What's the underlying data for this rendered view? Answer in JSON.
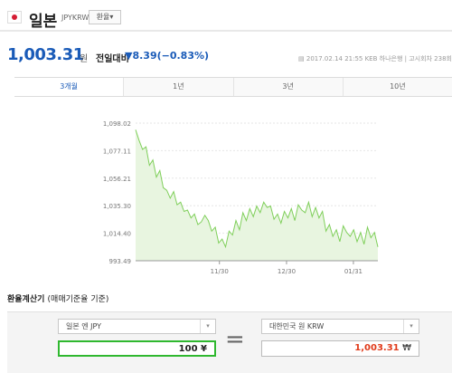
{
  "header": {
    "country": "일본",
    "code": "JPYKRW",
    "switch_label": "환율"
  },
  "rate": {
    "value": "1,003.31",
    "unit": "원",
    "prev_label": "전일대비",
    "change": "▼8.39(−0.83%)",
    "meta": "2017.02.14 21:55 KEB 하나은행 | 고시회차 238회"
  },
  "tabs": [
    "3개월",
    "1년",
    "3년",
    "10년"
  ],
  "chart_data": {
    "type": "area",
    "yticks": [
      "1,098.02",
      "1,077.11",
      "1,056.21",
      "1,035.30",
      "1,014.40",
      "993.49"
    ],
    "xticks": [
      "11/30",
      "12/30",
      "01/31"
    ],
    "ylim": [
      993.49,
      1098.02
    ],
    "fill_color": "#e8f5e0",
    "line_color": "#7fcf5a",
    "values": [
      1093,
      1085,
      1078,
      1080,
      1066,
      1070,
      1057,
      1062,
      1049,
      1047,
      1041,
      1046,
      1036,
      1038,
      1031,
      1032,
      1026,
      1029,
      1021,
      1023,
      1028,
      1024,
      1016,
      1019,
      1007,
      1010,
      1004,
      1016,
      1013,
      1024,
      1017,
      1030,
      1024,
      1033,
      1027,
      1035,
      1030,
      1038,
      1034,
      1035,
      1025,
      1029,
      1022,
      1031,
      1026,
      1033,
      1024,
      1036,
      1032,
      1030,
      1038,
      1027,
      1034,
      1026,
      1031,
      1016,
      1021,
      1012,
      1017,
      1008,
      1020,
      1015,
      1012,
      1017,
      1008,
      1015,
      1006,
      1019,
      1011,
      1015,
      1004
    ]
  },
  "calculator": {
    "title": "환율계산기",
    "subtitle": "(매매기준율 기준)",
    "from_currency": "일본 엔 JPY",
    "to_currency": "대한민국 원 KRW",
    "from_amount": "100",
    "from_symbol": "¥",
    "to_amount": "1,003.31",
    "to_symbol": "₩",
    "equals": "="
  }
}
